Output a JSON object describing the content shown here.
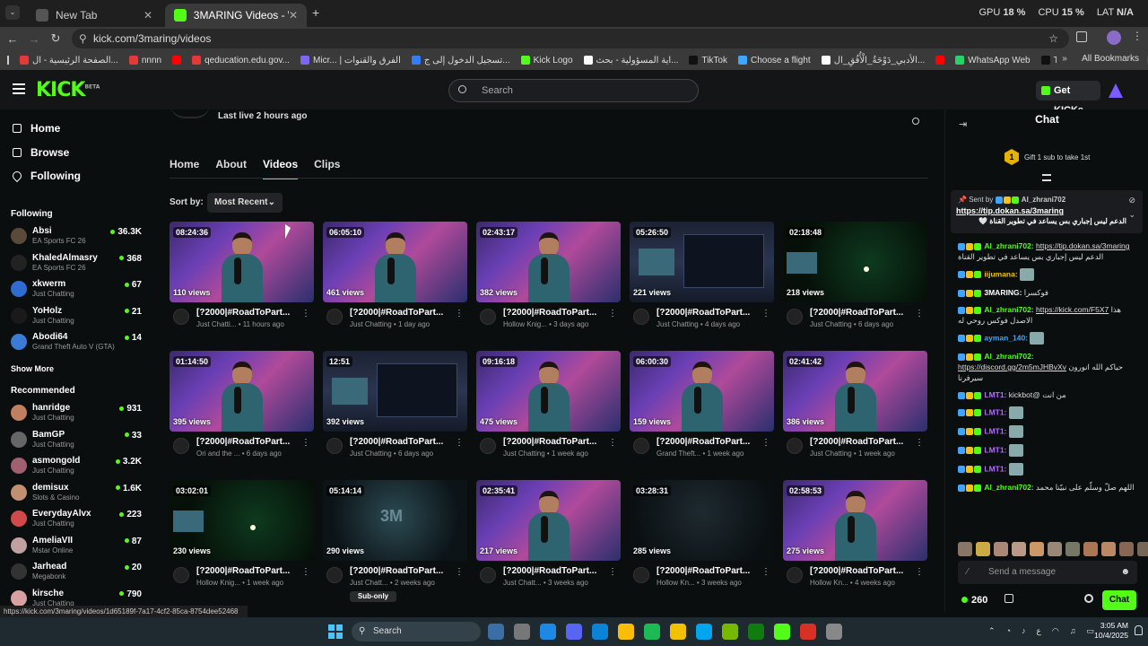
{
  "browser": {
    "tabs": [
      {
        "label": "New Tab",
        "active": false
      },
      {
        "label": "3MARING Videos - Watch On-D",
        "active": true
      }
    ],
    "system": {
      "gpu_label": "GPU",
      "gpu": "18 %",
      "cpu_label": "CPU",
      "cpu": "15 %",
      "lat_label": "LAT",
      "lat": "N/A"
    },
    "url": "kick.com/3maring/videos",
    "bookmarks": [
      {
        "label": "الصفحة الرئيسية - ال...",
        "color": "#e53935"
      },
      {
        "label": "nnnn",
        "color": "#e53935"
      },
      {
        "label": "",
        "color": "#ff0000"
      },
      {
        "label": "qeducation.edu.gov...",
        "color": "#e53935"
      },
      {
        "label": "Micr... | الفرق والقنوات",
        "color": "#7b68ee"
      },
      {
        "label": "تسجيل الدخول إلى ج...",
        "color": "#2f7ef6"
      },
      {
        "label": "Kick Logo",
        "color": "#53fc18"
      },
      {
        "label": "اية المسؤولية - بحث...",
        "color": "#ffffff"
      },
      {
        "label": "TikTok",
        "color": "#111111"
      },
      {
        "label": "Choose a flight",
        "color": "#3ea6ff"
      },
      {
        "label": "الأدبي_دَوْحَةُ_الْأُفُقِ_ال...",
        "color": "#ffffff"
      },
      {
        "label": "",
        "color": "#ff0000"
      },
      {
        "label": "WhatsApp Web",
        "color": "#25d366"
      },
      {
        "label": "TikTok - Make Your...",
        "color": "#111111"
      },
      {
        "label": "",
        "color": "#ff0000"
      }
    ],
    "all_bookmarks": "All Bookmarks"
  },
  "header": {
    "logo": "KICK",
    "logo_tag": "BETA",
    "search_placeholder": "Search",
    "get_kicks": "Get KICKs"
  },
  "sidebar": {
    "nav": [
      "Home",
      "Browse",
      "Following"
    ],
    "following_title": "Following",
    "following": [
      {
        "name": "Absi",
        "category": "EA Sports FC 26",
        "viewers": "36.3K",
        "color": "#5a4a3a"
      },
      {
        "name": "KhaledAlmasry",
        "category": "EA Sports FC 26",
        "viewers": "368",
        "color": "#222222"
      },
      {
        "name": "xkwerm",
        "category": "Just Chatting",
        "viewers": "67",
        "color": "#2f6ccf"
      },
      {
        "name": "YoHolz",
        "category": "Just Chatting",
        "viewers": "21",
        "color": "#1a1a1a"
      },
      {
        "name": "Abodi64",
        "category": "Grand Theft Auto V (GTA)",
        "viewers": "14",
        "color": "#3a7bd5"
      }
    ],
    "show_more": "Show More",
    "recommended_title": "Recommended",
    "recommended": [
      {
        "name": "hanridge",
        "category": "Just Chatting",
        "viewers": "931",
        "color": "#c08060"
      },
      {
        "name": "BamGP",
        "category": "Just Chatting",
        "viewers": "33",
        "color": "#666666"
      },
      {
        "name": "asmongold",
        "category": "Just Chatting",
        "viewers": "3.2K",
        "color": "#a06070"
      },
      {
        "name": "demisux",
        "category": "Slots & Casino",
        "viewers": "1.6K",
        "color": "#c09070"
      },
      {
        "name": "EverydayAlvx",
        "category": "Just Chatting",
        "viewers": "223",
        "color": "#d04a4a"
      },
      {
        "name": "AmeliaVII",
        "category": "Mstar Online",
        "viewers": "87",
        "color": "#c0a0a0"
      },
      {
        "name": "Jarhead",
        "category": "Megabonk",
        "viewers": "20",
        "color": "#333333"
      },
      {
        "name": "kirsche",
        "category": "Just Chatting",
        "viewers": "790",
        "color": "#d8a0a0"
      }
    ]
  },
  "channel": {
    "last_live": "Last live 2 hours ago",
    "tabs": [
      "Home",
      "About",
      "Videos",
      "Clips"
    ],
    "active_tab": "Videos",
    "sort_label": "Sort by:",
    "sort_value": "Most Recent"
  },
  "videos": [
    {
      "duration": "08:24:36",
      "views": "110 views",
      "title": "[?2000|#RoadToPart...",
      "category": "Just Chatti...",
      "age": "11 hours ago",
      "style": "cam"
    },
    {
      "duration": "06:05:10",
      "views": "461 views",
      "title": "[?2000|#RoadToPart...",
      "category": "Just Chatting",
      "age": "1 day ago",
      "style": "cam"
    },
    {
      "duration": "02:43:17",
      "views": "382 views",
      "title": "[?2000|#RoadToPart...",
      "category": "Hollow Knig...",
      "age": "3 days ago",
      "style": "cam"
    },
    {
      "duration": "05:26:50",
      "views": "221 views",
      "title": "[?2000|#RoadToPart...",
      "category": "Just Chatting",
      "age": "4 days ago",
      "style": "screen"
    },
    {
      "duration": "02:18:48",
      "views": "218 views",
      "title": "[?2000|#RoadToPart...",
      "category": "Just Chatting",
      "age": "6 days ago",
      "style": "game"
    },
    {
      "duration": "01:14:50",
      "views": "395 views",
      "title": "[?2000|#RoadToPart...",
      "category": "Ori and the ...",
      "age": "6 days ago",
      "style": "cam"
    },
    {
      "duration": "12:51",
      "views": "392 views",
      "title": "[?2000|#RoadToPart...",
      "category": "Just Chatting",
      "age": "6 days ago",
      "style": "screen"
    },
    {
      "duration": "09:16:18",
      "views": "475 views",
      "title": "[?2000|#RoadToPart...",
      "category": "Just Chatting",
      "age": "1 week ago",
      "style": "cam"
    },
    {
      "duration": "06:00:30",
      "views": "159 views",
      "title": "[?2000|#RoadToPart...",
      "category": "Grand Theft...",
      "age": "1 week ago",
      "style": "cam"
    },
    {
      "duration": "02:41:42",
      "views": "386 views",
      "title": "[?2000|#RoadToPart...",
      "category": "Just Chatting",
      "age": "1 week ago",
      "style": "cam"
    },
    {
      "duration": "03:02:01",
      "views": "230 views",
      "title": "[?2000|#RoadToPart...",
      "category": "Hollow Knig...",
      "age": "1 week ago",
      "style": "game"
    },
    {
      "duration": "05:14:14",
      "views": "290 views",
      "title": "[?2000|#RoadToPart...",
      "category": "Just Chatt...",
      "age": "2 weeks ago",
      "style": "logo",
      "sub_only": "Sub-only"
    },
    {
      "duration": "02:35:41",
      "views": "217 views",
      "title": "[?2000|#RoadToPart...",
      "category": "Just Chatt...",
      "age": "3 weeks ago",
      "style": "cam"
    },
    {
      "duration": "03:28:31",
      "views": "285 views",
      "title": "[?2000|#RoadToPart...",
      "category": "Hollow Kn...",
      "age": "3 weeks ago",
      "style": "dark"
    },
    {
      "duration": "02:58:53",
      "views": "275 views",
      "title": "[?2000|#RoadToPart...",
      "category": "Hollow Kn...",
      "age": "4 weeks ago",
      "style": "cam"
    }
  ],
  "chat": {
    "title": "Chat",
    "gift_count": "1",
    "gift_text": "Gift 1 sub to take 1st",
    "pinned_sender_label": "Sent by",
    "pinned_sender": "Al_zhrani702",
    "pinned_link": "https://tip.dokan.sa/3maring",
    "pinned_text": "الدعم ليس إجباري بس يساعد في تطوير القناة 🤍",
    "messages": [
      {
        "user": "Al_zhrani702:",
        "color": "#53fc18",
        "link": "https://tip.dokan.sa/3maring",
        "text": "الدعم ليس إجباري بس يساعد في تطوير القناة"
      },
      {
        "user": "iijumana:",
        "color": "#f0c419",
        "link": "",
        "text": ""
      },
      {
        "user": "3MARING:",
        "color": "#ffffff",
        "link": "",
        "text": "فوكسرا"
      },
      {
        "user": "Al_zhrani702:",
        "color": "#53fc18",
        "link": "https://kick.com/F5X7",
        "text": "هذا الاصدل فوكس روحي له"
      },
      {
        "user": "ayman_140:",
        "color": "#3ea6ff",
        "link": "",
        "text": ""
      },
      {
        "user": "Al_zhrani702:",
        "color": "#53fc18",
        "link": "https://discord.gg/2m5mJHBvXv",
        "text": "حياكم الله انورون سيرفرنا"
      },
      {
        "user": "LMT1:",
        "color": "#b36bff",
        "link": "",
        "text": "من انت @kickbot"
      },
      {
        "user": "LMT1:",
        "color": "#b36bff",
        "link": "",
        "text": ""
      },
      {
        "user": "LMT1:",
        "color": "#b36bff",
        "link": "",
        "text": ""
      },
      {
        "user": "LMT1:",
        "color": "#b36bff",
        "link": "",
        "text": ""
      },
      {
        "user": "LMT1:",
        "color": "#b36bff",
        "link": "",
        "text": ""
      },
      {
        "user": "Al_zhrani702:",
        "color": "#53fc18",
        "link": "",
        "text": "اللهم صلّ وسلّم على نبيّنا محمد"
      }
    ],
    "send_placeholder": "Send a message",
    "kicks_balance": "260",
    "chat_button": "Chat"
  },
  "status_url": "https://kick.com/3maring/videos/1d65189f-7a17-4cf2-85ca-8754dee52468",
  "taskbar": {
    "search": "Search",
    "lang": "ع",
    "time": "3:05 AM",
    "date": "10/4/2025",
    "apps": [
      "#3a6ea5",
      "#777777",
      "#1e88e5",
      "#5865f2",
      "#0b84d8",
      "#fbbc05",
      "#1db954",
      "#f2c200",
      "#00a4ef",
      "#76b900",
      "#107c10",
      "#53fc18",
      "#d93025",
      "#888888"
    ]
  }
}
